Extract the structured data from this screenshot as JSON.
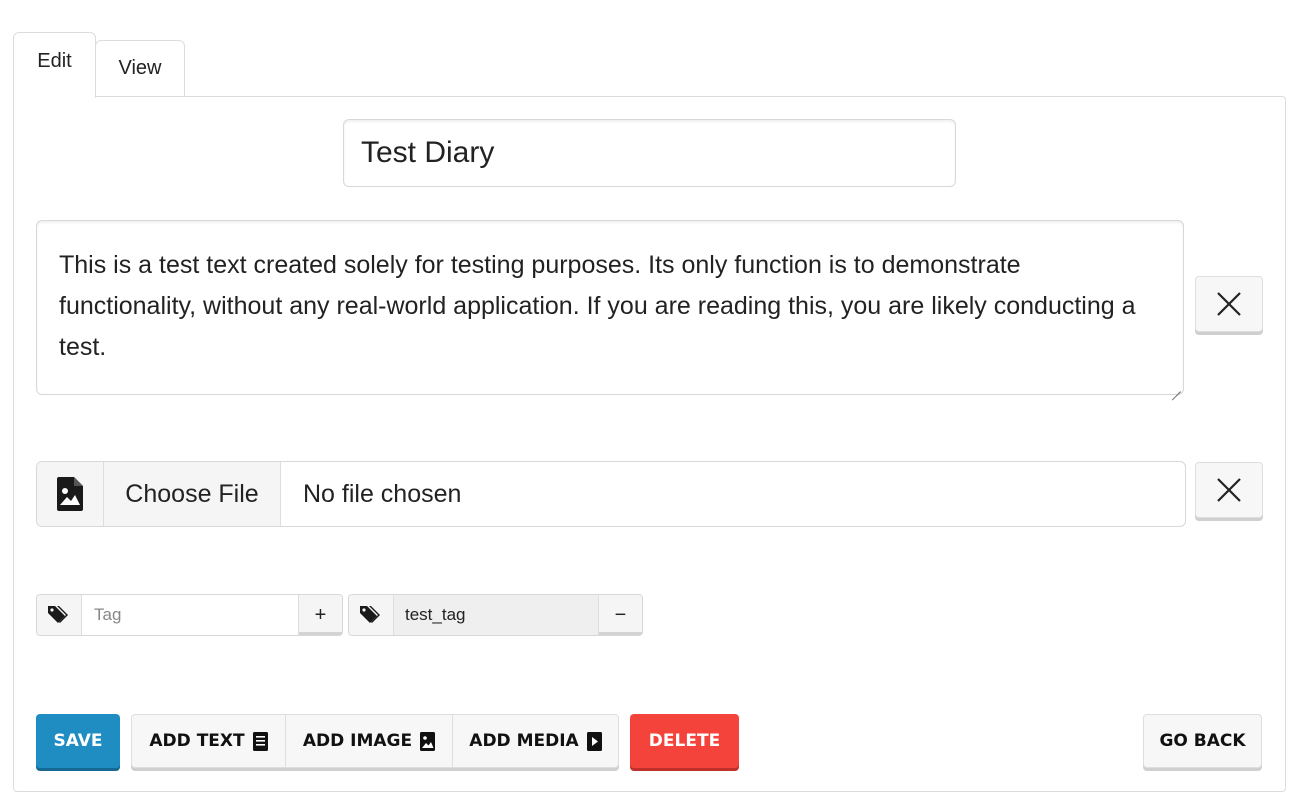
{
  "tabs": {
    "edit": "Edit",
    "view": "View"
  },
  "title_input": {
    "value": "Test Diary"
  },
  "text_block": {
    "value": "This is a test text created solely for testing purposes. Its only function is to demonstrate functionality, without any real-world application. If you are reading this, you are likely conducting a test."
  },
  "file_input": {
    "button_label": "Choose File",
    "status": "No file chosen"
  },
  "tags": {
    "new_placeholder": "Tag",
    "add_label": "+",
    "existing": [
      {
        "value": "test_tag",
        "remove_label": "−"
      }
    ]
  },
  "actions": {
    "save": "SAVE",
    "add_text": "ADD TEXT",
    "add_image": "ADD IMAGE",
    "add_media": "ADD MEDIA",
    "delete": "DELETE",
    "go_back": "GO BACK"
  },
  "colors": {
    "save": "#1f8dc2",
    "delete": "#f4433a"
  },
  "icons": {
    "remove_text": "close-icon",
    "remove_file": "close-icon",
    "file": "image-file-icon",
    "tag": "tag-icon",
    "add_text": "document-icon",
    "add_image": "image-icon",
    "add_media": "play-icon"
  }
}
